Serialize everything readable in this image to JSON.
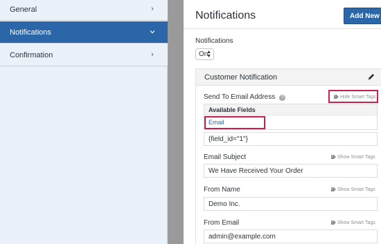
{
  "sidebar": {
    "items": [
      {
        "label": "General",
        "active": false
      },
      {
        "label": "Notifications",
        "active": true
      },
      {
        "label": "Confirmation",
        "active": false
      }
    ]
  },
  "header": {
    "title": "Notifications",
    "add_button": "Add New No"
  },
  "notifications_toggle": {
    "label": "Notifications",
    "value": "On"
  },
  "notification": {
    "title": "Customer Notification",
    "send_to": {
      "label": "Send To Email Address",
      "smart_tags": "Hide Smart Tags",
      "available_fields_header": "Available Fields",
      "available_field": "Email",
      "value": "{field_id=\"1\"}"
    },
    "email_subject": {
      "label": "Email Subject",
      "smart_tags": "Show Smart Tags",
      "value": "We Have Received Your Order"
    },
    "from_name": {
      "label": "From Name",
      "smart_tags": "Show Smart Tags",
      "value": "Demo Inc."
    },
    "from_email": {
      "label": "From Email",
      "smart_tags": "Show Smart Tags",
      "value": "admin@example.com"
    }
  },
  "colors": {
    "accent": "#2b66a8",
    "highlight": "#c81e4a",
    "sidebar_bg": "#ebf1f8"
  },
  "icons": [
    "chevron-right-icon",
    "chevron-down-icon",
    "select-arrows-icon",
    "pencil-icon",
    "help-icon",
    "tag-icon"
  ]
}
